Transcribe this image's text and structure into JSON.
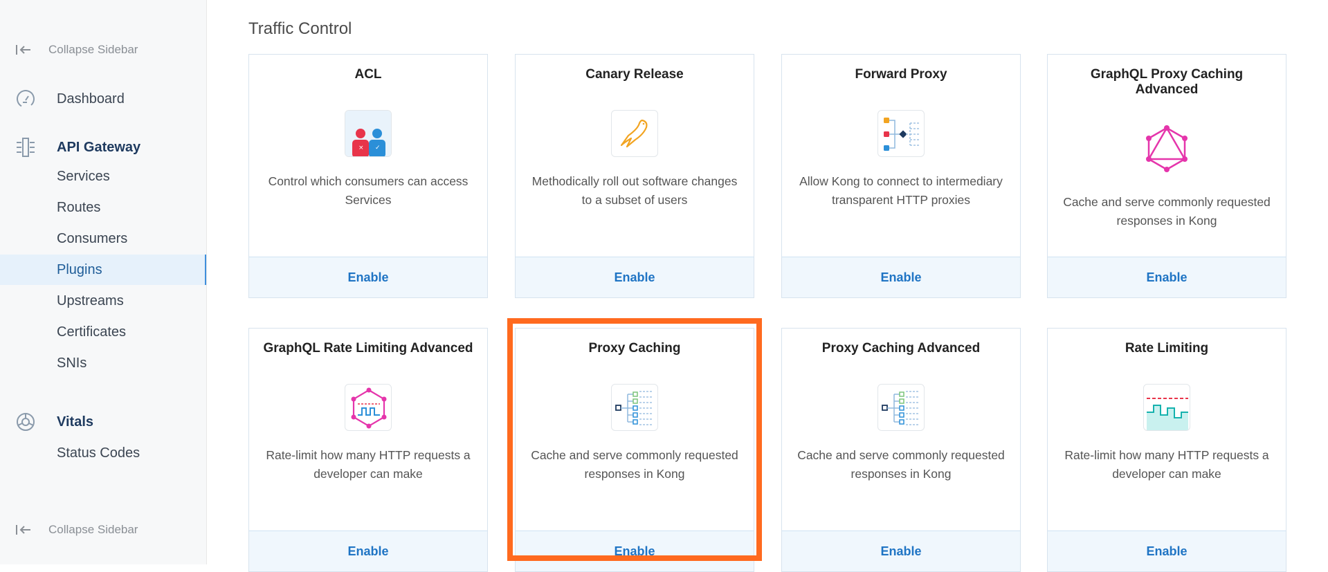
{
  "sidebar": {
    "collapse_top": "Collapse Sidebar",
    "dashboard": "Dashboard",
    "api_gateway": "API Gateway",
    "items": [
      "Services",
      "Routes",
      "Consumers",
      "Plugins",
      "Upstreams",
      "Certificates",
      "SNIs"
    ],
    "active_item": "Plugins",
    "vitals": "Vitals",
    "vitals_items": [
      "Status Codes"
    ],
    "collapse_bottom": "Collapse Sidebar"
  },
  "main": {
    "section_title": "Traffic Control",
    "cards": [
      {
        "title": "ACL",
        "icon": "acl-users-icon",
        "description": "Control which consumers can access Services",
        "button": "Enable"
      },
      {
        "title": "Canary Release",
        "icon": "canary-bird-icon",
        "description": "Methodically roll out software changes to a subset of users",
        "button": "Enable"
      },
      {
        "title": "Forward Proxy",
        "icon": "forward-proxy-icon",
        "description": "Allow Kong to connect to intermediary transparent HTTP proxies",
        "button": "Enable"
      },
      {
        "title": "GraphQL Proxy Caching Advanced",
        "icon": "graphql-icon",
        "description": "Cache and serve commonly requested responses in Kong",
        "button": "Enable"
      },
      {
        "title": "GraphQL Rate Limiting Advanced",
        "icon": "graphql-rate-limit-icon",
        "description": "Rate-limit how many HTTP requests a developer can make",
        "button": "Enable"
      },
      {
        "title": "Proxy Caching",
        "icon": "proxy-caching-icon",
        "description": "Cache and serve commonly requested responses in Kong",
        "button": "Enable"
      },
      {
        "title": "Proxy Caching Advanced",
        "icon": "proxy-caching-advanced-icon",
        "description": "Cache and serve commonly requested responses in Kong",
        "button": "Enable"
      },
      {
        "title": "Rate Limiting",
        "icon": "rate-limiting-icon",
        "description": "Rate-limit how many HTTP requests a developer can make",
        "button": "Enable"
      }
    ],
    "highlighted_card": "Proxy Caching"
  },
  "colors": {
    "accent": "#1f74c4",
    "highlight": "#ff6a1f",
    "active_bg": "#e6f1fb"
  }
}
